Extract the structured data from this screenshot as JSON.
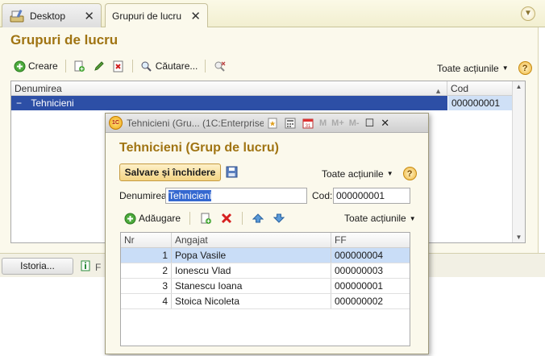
{
  "tabs": {
    "desktop_label": "Desktop",
    "active_label": "Grupuri de lucru",
    "close_glyph": "✕"
  },
  "main": {
    "title": "Grupuri de lucru",
    "toolbar": {
      "create_label": "Creare",
      "search_label": "Căutare...",
      "all_actions_label": "Toate acțiunile",
      "help_glyph": "?"
    },
    "list": {
      "columns": [
        "Denumirea",
        "Cod"
      ],
      "rows": [
        {
          "name": "Tehnicieni",
          "code": "000000001",
          "expander": "−"
        }
      ]
    }
  },
  "bottom": {
    "history_label": "Istoria...",
    "partial_label": "F"
  },
  "modal": {
    "window_title": "Tehnicieni (Gru...   (1C:Enterprise)",
    "memory_buttons": [
      "M",
      "M+",
      "M-"
    ],
    "heading": "Tehnicieni (Grup de lucru)",
    "save_close_label": "Salvare și închidere",
    "all_actions_label": "Toate acțiunile",
    "help_glyph": "?",
    "name_label": "Denumirea:",
    "name_value": "Tehnicieni",
    "code_label": "Cod:",
    "code_value": "000000001",
    "add_label": "Adăugare",
    "all_actions_label_2": "Toate acțiunile",
    "grid": {
      "columns": [
        "Nr",
        "Angajat",
        "FF"
      ],
      "rows": [
        {
          "nr": "1",
          "employee": "Popa Vasile",
          "ff": "000000004"
        },
        {
          "nr": "2",
          "employee": "Ionescu Vlad",
          "ff": "000000003"
        },
        {
          "nr": "3",
          "employee": "Stanescu Ioana",
          "ff": "000000001"
        },
        {
          "nr": "4",
          "employee": "Stoica Nicoleta",
          "ff": "000000002"
        }
      ]
    }
  },
  "colors": {
    "title_gold": "#a07412",
    "selection_blue": "#2d4fa6",
    "panel_bg": "#fbf9ec"
  }
}
